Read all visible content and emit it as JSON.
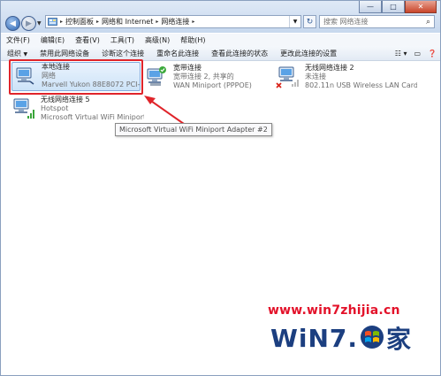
{
  "window": {
    "btn_min": "—",
    "btn_max": "□",
    "btn_close": "✕"
  },
  "address": {
    "crumbs": [
      "控制面板",
      "网络和 Internet",
      "网络连接"
    ],
    "sep": "▸",
    "search_placeholder": "搜索 网络连接"
  },
  "menu": [
    "文件(F)",
    "编辑(E)",
    "查看(V)",
    "工具(T)",
    "高级(N)",
    "帮助(H)"
  ],
  "commands": {
    "organize": "组织",
    "disable": "禁用此网络设备",
    "diagnose": "诊断这个连接",
    "rename": "重命名此连接",
    "status": "查看此连接的状态",
    "change": "更改此连接的设置"
  },
  "connections": [
    {
      "name": "本地连接",
      "status": "网络",
      "device": "Marvell Yukon 88E8072 PCI-E ..."
    },
    {
      "name": "宽带连接",
      "status": "宽带连接 2, 共享的",
      "device": "WAN Miniport (PPPOE)"
    },
    {
      "name": "无线网络连接 2",
      "status": "未连接",
      "device": "802.11n USB Wireless LAN Card"
    },
    {
      "name": "无线网络连接 5",
      "status": "Hotspot",
      "device": "Microsoft Virtual WiFi Miniport ..."
    }
  ],
  "tooltip": "Microsoft Virtual WiFi Miniport Adapter #2",
  "watermark": {
    "url": "www.win7zhijia.cn",
    "logo_text": "WiN7.",
    "logo_char": "家"
  },
  "colors": {
    "highlight_box": "#e0242a",
    "watermark_red": "#e3122a",
    "watermark_blue": "#1c3f80"
  }
}
